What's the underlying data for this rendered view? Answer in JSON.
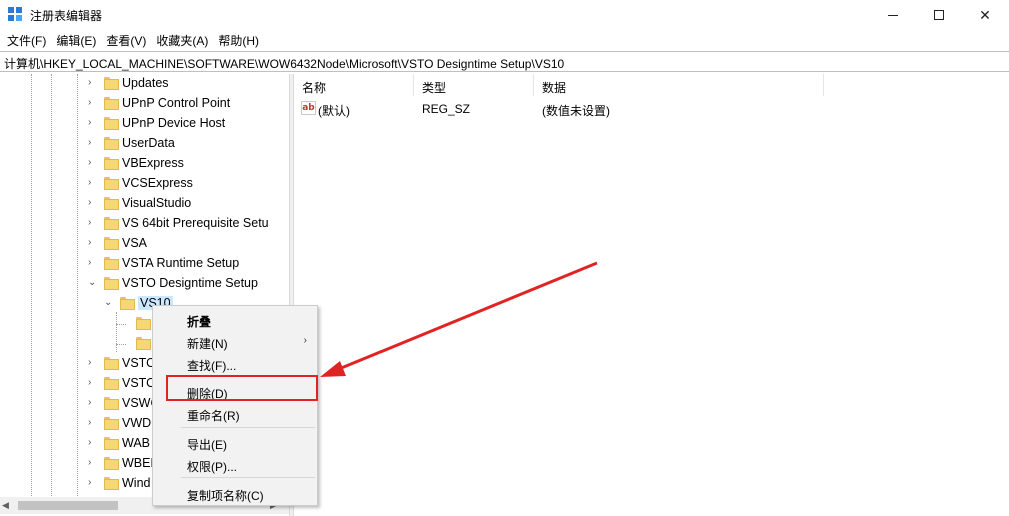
{
  "window": {
    "title": "注册表编辑器",
    "minimize_icon": "minimize-icon",
    "maximize_icon": "maximize-icon",
    "close_icon": "close-icon",
    "close_glyph": "✕"
  },
  "menubar": [
    "文件(F)",
    "编辑(E)",
    "查看(V)",
    "收藏夹(A)",
    "帮助(H)"
  ],
  "address": "计算机\\HKEY_LOCAL_MACHINE\\SOFTWARE\\WOW6432Node\\Microsoft\\VSTO Designtime Setup\\VS10",
  "tree": {
    "items": [
      {
        "label": "Updates",
        "expanded": false
      },
      {
        "label": "UPnP Control Point",
        "expanded": false
      },
      {
        "label": "UPnP Device Host",
        "expanded": false
      },
      {
        "label": "UserData",
        "expanded": false
      },
      {
        "label": "VBExpress",
        "expanded": false
      },
      {
        "label": "VCSExpress",
        "expanded": false
      },
      {
        "label": "VisualStudio",
        "expanded": false
      },
      {
        "label": "VS 64bit Prerequisite Setu",
        "expanded": false
      },
      {
        "label": "VSA",
        "expanded": false
      },
      {
        "label": "VSTA Runtime Setup",
        "expanded": false
      },
      {
        "label": "VSTO Designtime Setup",
        "expanded": true
      },
      {
        "label": "VS10",
        "expanded": true,
        "selected": true
      },
      {
        "label": "",
        "expanded": false
      },
      {
        "label": "",
        "expanded": false
      },
      {
        "label": "VSTO",
        "expanded": false
      },
      {
        "label": "VSTO",
        "expanded": false
      },
      {
        "label": "VSWC",
        "expanded": false
      },
      {
        "label": "VWD",
        "expanded": false
      },
      {
        "label": "WAB",
        "expanded": false
      },
      {
        "label": "WBEM",
        "expanded": false
      },
      {
        "label": "Wind",
        "expanded": false
      }
    ],
    "expand_glyph": "›",
    "collapse_glyph": "⌄"
  },
  "list": {
    "columns": [
      "名称",
      "类型",
      "数据"
    ],
    "rows": [
      {
        "name": "(默认)",
        "type": "REG_SZ",
        "data": "(数值未设置)",
        "icon": "string-value-icon",
        "icon_text": "ab"
      }
    ]
  },
  "context_menu": {
    "items": [
      {
        "label": "折叠",
        "bold": true
      },
      {
        "label": "新建(N)",
        "submenu": true
      },
      {
        "label": "查找(F)..."
      },
      {
        "label": "删除(D)",
        "highlighted": true
      },
      {
        "label": "重命名(R)"
      },
      {
        "label": "导出(E)"
      },
      {
        "label": "权限(P)..."
      },
      {
        "label": "复制项名称(C)"
      }
    ],
    "submenu_glyph": "›"
  },
  "annotation": {
    "color": "#e02424"
  },
  "colors": {
    "selection": "#cce8ff",
    "menu_bg": "#f2f2f2",
    "folder": "#f7d774"
  }
}
